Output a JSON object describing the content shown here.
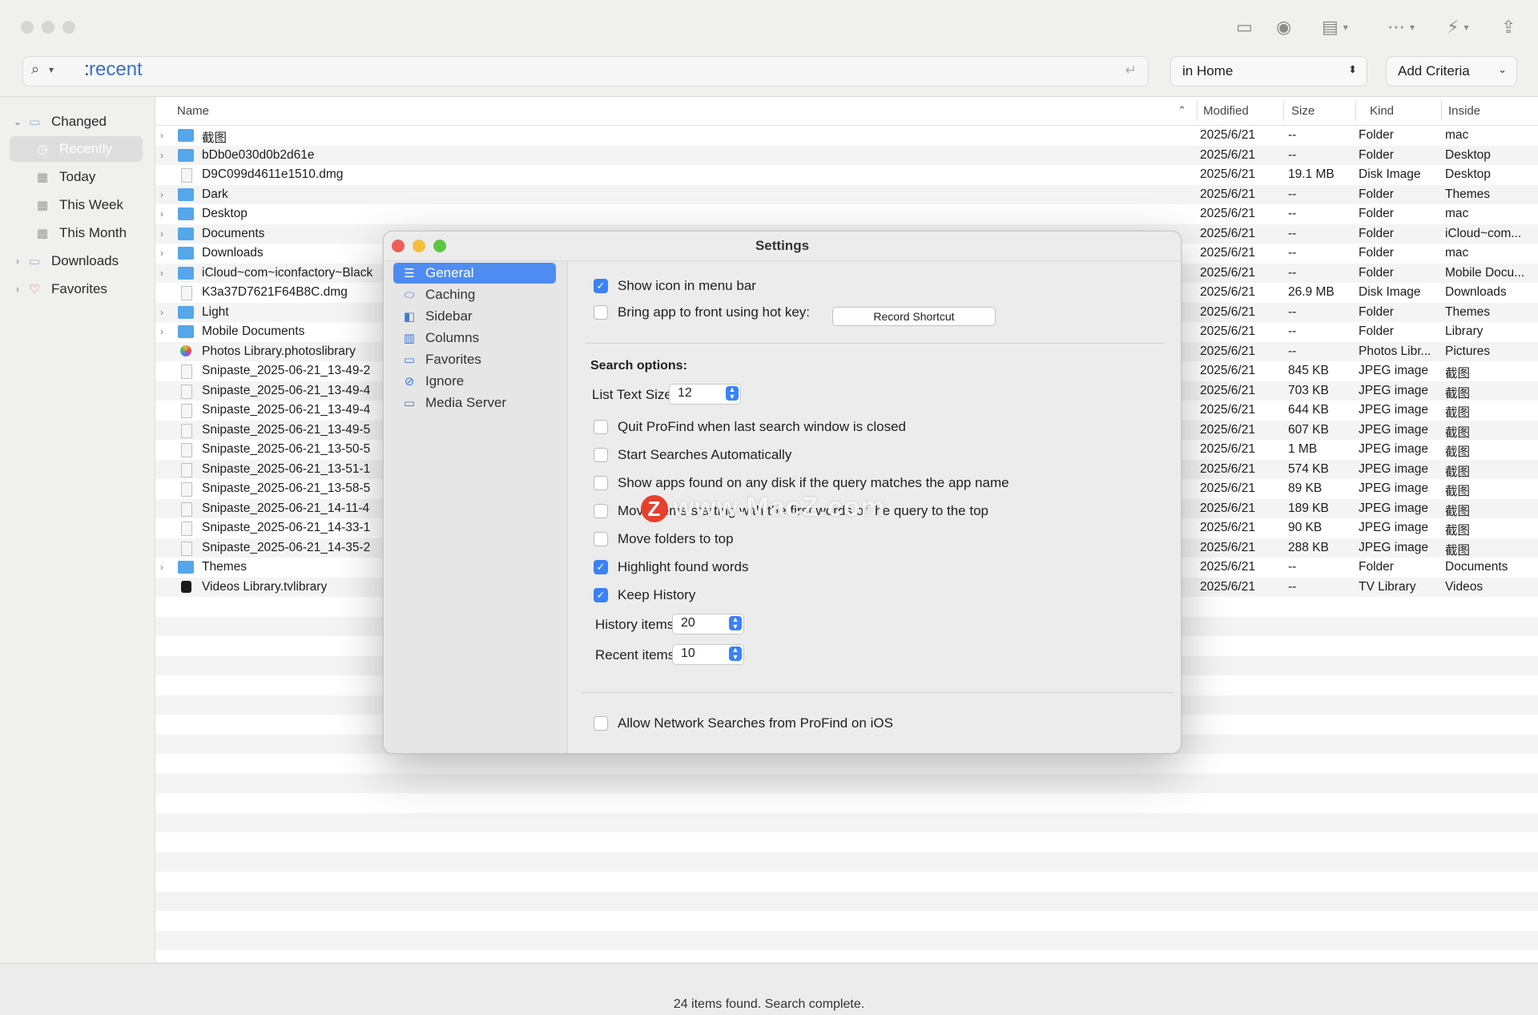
{
  "toolbar": {
    "search_value": "recent",
    "scope": "in Home",
    "add_criteria": "Add Criteria"
  },
  "sidebar": {
    "changed": "Changed",
    "recently": "Recently",
    "today": "Today",
    "this_week": "This Week",
    "this_month": "This Month",
    "downloads": "Downloads",
    "favorites": "Favorites"
  },
  "columns": {
    "name": "Name",
    "modified": "Modified",
    "size": "Size",
    "kind": "Kind",
    "inside": "Inside"
  },
  "files": [
    {
      "name": "截图",
      "modified": "2025/6/21",
      "size": "--",
      "kind": "Folder",
      "inside": "mac",
      "icon": "folder",
      "expandable": true
    },
    {
      "name": "bDb0e030d0b2d61e",
      "modified": "2025/6/21",
      "size": "--",
      "kind": "Folder",
      "inside": "Desktop",
      "icon": "folder",
      "expandable": true
    },
    {
      "name": "D9C099d4611e1510.dmg",
      "modified": "2025/6/21",
      "size": "19.1 MB",
      "kind": "Disk Image",
      "inside": "Desktop",
      "icon": "doc",
      "expandable": false
    },
    {
      "name": "Dark",
      "modified": "2025/6/21",
      "size": "--",
      "kind": "Folder",
      "inside": "Themes",
      "icon": "folder",
      "expandable": true
    },
    {
      "name": "Desktop",
      "modified": "2025/6/21",
      "size": "--",
      "kind": "Folder",
      "inside": "mac",
      "icon": "folder",
      "expandable": true
    },
    {
      "name": "Documents",
      "modified": "2025/6/21",
      "size": "--",
      "kind": "Folder",
      "inside": "iCloud~com...",
      "icon": "folder",
      "expandable": true
    },
    {
      "name": "Downloads",
      "modified": "2025/6/21",
      "size": "--",
      "kind": "Folder",
      "inside": "mac",
      "icon": "folder",
      "expandable": true
    },
    {
      "name": "iCloud~com~iconfactory~Black",
      "modified": "2025/6/21",
      "size": "--",
      "kind": "Folder",
      "inside": "Mobile Docu...",
      "icon": "folder",
      "expandable": true
    },
    {
      "name": "K3a37D7621F64B8C.dmg",
      "modified": "2025/6/21",
      "size": "26.9 MB",
      "kind": "Disk Image",
      "inside": "Downloads",
      "icon": "doc",
      "expandable": false
    },
    {
      "name": "Light",
      "modified": "2025/6/21",
      "size": "--",
      "kind": "Folder",
      "inside": "Themes",
      "icon": "folder",
      "expandable": true
    },
    {
      "name": "Mobile Documents",
      "modified": "2025/6/21",
      "size": "--",
      "kind": "Folder",
      "inside": "Library",
      "icon": "folder",
      "expandable": true
    },
    {
      "name": "Photos Library.photoslibrary",
      "modified": "2025/6/21",
      "size": "--",
      "kind": "Photos Libr...",
      "inside": "Pictures",
      "icon": "photo",
      "expandable": false
    },
    {
      "name": "Snipaste_2025-06-21_13-49-2",
      "modified": "2025/6/21",
      "size": "845 KB",
      "kind": "JPEG image",
      "inside": "截图",
      "icon": "doc",
      "expandable": false
    },
    {
      "name": "Snipaste_2025-06-21_13-49-4",
      "modified": "2025/6/21",
      "size": "703 KB",
      "kind": "JPEG image",
      "inside": "截图",
      "icon": "doc",
      "expandable": false
    },
    {
      "name": "Snipaste_2025-06-21_13-49-4",
      "modified": "2025/6/21",
      "size": "644 KB",
      "kind": "JPEG image",
      "inside": "截图",
      "icon": "doc",
      "expandable": false
    },
    {
      "name": "Snipaste_2025-06-21_13-49-5",
      "modified": "2025/6/21",
      "size": "607 KB",
      "kind": "JPEG image",
      "inside": "截图",
      "icon": "doc",
      "expandable": false
    },
    {
      "name": "Snipaste_2025-06-21_13-50-5",
      "modified": "2025/6/21",
      "size": "1 MB",
      "kind": "JPEG image",
      "inside": "截图",
      "icon": "doc",
      "expandable": false
    },
    {
      "name": "Snipaste_2025-06-21_13-51-1",
      "modified": "2025/6/21",
      "size": "574 KB",
      "kind": "JPEG image",
      "inside": "截图",
      "icon": "doc",
      "expandable": false
    },
    {
      "name": "Snipaste_2025-06-21_13-58-5",
      "modified": "2025/6/21",
      "size": "89 KB",
      "kind": "JPEG image",
      "inside": "截图",
      "icon": "doc",
      "expandable": false
    },
    {
      "name": "Snipaste_2025-06-21_14-11-4",
      "modified": "2025/6/21",
      "size": "189 KB",
      "kind": "JPEG image",
      "inside": "截图",
      "icon": "doc",
      "expandable": false
    },
    {
      "name": "Snipaste_2025-06-21_14-33-1",
      "modified": "2025/6/21",
      "size": "90 KB",
      "kind": "JPEG image",
      "inside": "截图",
      "icon": "doc",
      "expandable": false
    },
    {
      "name": "Snipaste_2025-06-21_14-35-2",
      "modified": "2025/6/21",
      "size": "288 KB",
      "kind": "JPEG image",
      "inside": "截图",
      "icon": "doc",
      "expandable": false
    },
    {
      "name": "Themes",
      "modified": "2025/6/21",
      "size": "--",
      "kind": "Folder",
      "inside": "Documents",
      "icon": "folder",
      "expandable": true
    },
    {
      "name": "Videos Library.tvlibrary",
      "modified": "2025/6/21",
      "size": "--",
      "kind": "TV Library",
      "inside": "Videos",
      "icon": "tv",
      "expandable": false
    }
  ],
  "status": "24 items found. Search complete.",
  "settings": {
    "title": "Settings",
    "panes": [
      "General",
      "Caching",
      "Sidebar",
      "Columns",
      "Favorites",
      "Ignore",
      "Media Server"
    ],
    "show_icon_menu_bar": "Show icon in menu bar",
    "bring_app_front": "Bring app to front using hot key:",
    "record_shortcut": "Record Shortcut",
    "search_options": "Search options:",
    "list_text_size_label": "List Text Size:",
    "list_text_size_value": "12",
    "quit_profind": "Quit ProFind when last search window is closed",
    "start_searches": "Start Searches Automatically",
    "show_apps": "Show apps found on any disk if the query matches the app name",
    "move_items": "Move items starting with the first words of the query to the top",
    "move_folders": "Move folders to top",
    "highlight_found": "Highlight found words",
    "keep_history": "Keep History",
    "history_items_label": "History items:",
    "history_items_value": "20",
    "recent_items_label": "Recent items:",
    "recent_items_value": "10",
    "allow_network": "Allow Network Searches from ProFind on iOS"
  },
  "watermark": "www.MacZ.com",
  "colors": {
    "accent": "#3b82f6",
    "selection": "#4e8cf2",
    "folder": "#56a6ea"
  }
}
